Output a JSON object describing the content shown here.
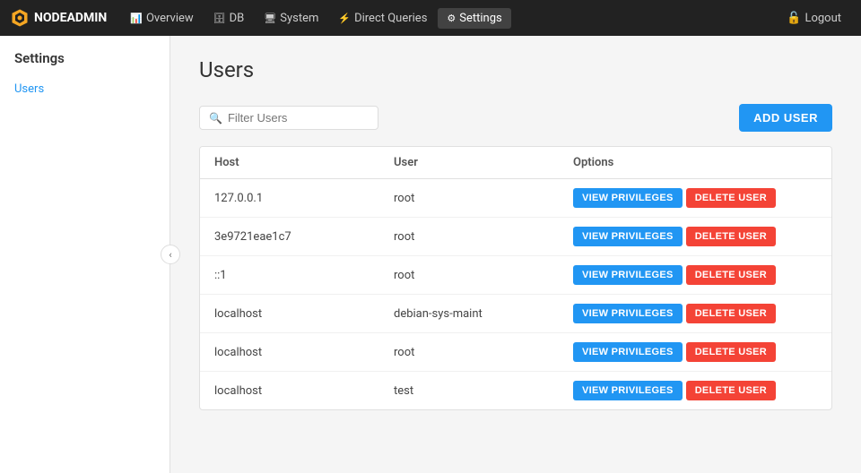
{
  "navbar": {
    "brand": "NODEADMIN",
    "logout_label": "Logout",
    "items": [
      {
        "id": "overview",
        "label": "Overview",
        "icon": "📊",
        "active": false
      },
      {
        "id": "db",
        "label": "DB",
        "icon": "🗄",
        "active": false
      },
      {
        "id": "system",
        "label": "System",
        "icon": "🖥",
        "active": false
      },
      {
        "id": "direct-queries",
        "label": "Direct Queries",
        "icon": "⚡",
        "active": false
      },
      {
        "id": "settings",
        "label": "Settings",
        "icon": "⚙",
        "active": true
      }
    ]
  },
  "sidebar": {
    "title": "Settings",
    "items": [
      {
        "id": "users",
        "label": "Users",
        "active": true
      }
    ]
  },
  "main": {
    "page_title": "Users",
    "search_placeholder": "Filter Users",
    "add_user_label": "ADD USER",
    "table": {
      "columns": [
        "Host",
        "User",
        "Options"
      ],
      "rows": [
        {
          "host": "127.0.0.1",
          "user": "root"
        },
        {
          "host": "3e9721eae1c7",
          "user": "root"
        },
        {
          "host": "::1",
          "user": "root"
        },
        {
          "host": "localhost",
          "user": "debian-sys-maint"
        },
        {
          "host": "localhost",
          "user": "root"
        },
        {
          "host": "localhost",
          "user": "test"
        }
      ],
      "view_privileges_label": "VIEW PRIVILEGES",
      "delete_user_label": "DELETE USER"
    }
  }
}
